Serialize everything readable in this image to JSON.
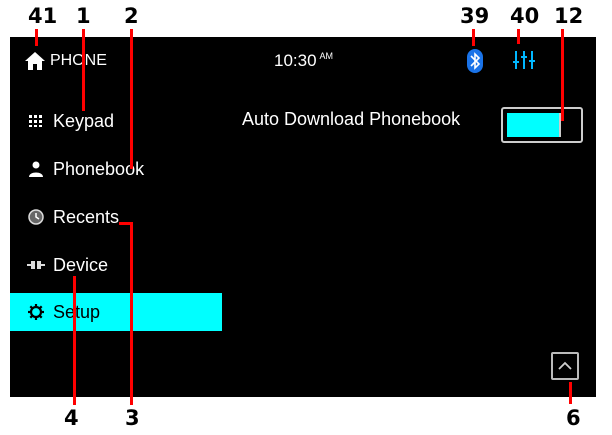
{
  "callouts": {
    "c41": "41",
    "c1": "1",
    "c2": "2",
    "c39": "39",
    "c40": "40",
    "c12": "12",
    "c4": "4",
    "c3": "3",
    "c6": "6"
  },
  "header": {
    "app_title": "PHONE",
    "time": "10:30",
    "ampm": "AM"
  },
  "sidebar": {
    "items": [
      {
        "label": "Keypad",
        "icon": "keypad-icon"
      },
      {
        "label": "Phonebook",
        "icon": "person-icon"
      },
      {
        "label": "Recents",
        "icon": "recents-icon"
      },
      {
        "label": "Device",
        "icon": "device-icon"
      },
      {
        "label": "Setup",
        "icon": "gear-icon"
      }
    ],
    "active_index": 4
  },
  "settings": {
    "auto_download_label": "Auto Download Phonebook",
    "auto_download_on": true
  },
  "colors": {
    "accent": "#00ffff",
    "bluetooth": "#1a73e8",
    "eq": "#00b7ff",
    "leader": "#ff0000"
  }
}
